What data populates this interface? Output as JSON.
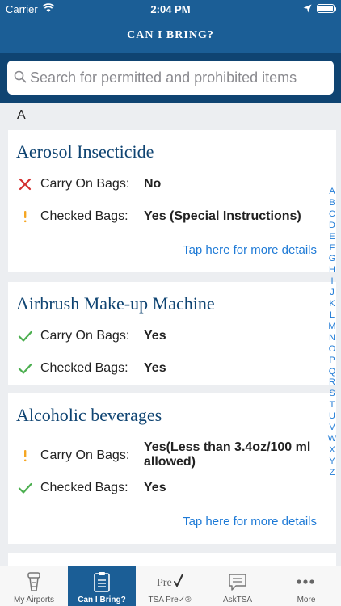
{
  "status": {
    "carrier": "Carrier",
    "time": "2:04 PM"
  },
  "nav": {
    "title": "CAN I BRING?"
  },
  "search": {
    "placeholder": "Search for permitted and prohibited items"
  },
  "section": {
    "letter": "A"
  },
  "items": [
    {
      "title": "Aerosol Insecticide",
      "carry_on_label": "Carry On Bags:",
      "carry_on_value": "No",
      "carry_on_status": "no",
      "checked_label": "Checked Bags:",
      "checked_value": "Yes (Special Instructions)",
      "checked_status": "special",
      "details": "Tap here for more details"
    },
    {
      "title": "Airbrush Make-up Machine",
      "carry_on_label": "Carry On Bags:",
      "carry_on_value": "Yes",
      "carry_on_status": "yes",
      "checked_label": "Checked Bags:",
      "checked_value": "Yes",
      "checked_status": "yes"
    },
    {
      "title": "Alcoholic beverages",
      "carry_on_label": "Carry On Bags:",
      "carry_on_value": "Yes(Less than 3.4oz/100 ml allowed)",
      "carry_on_status": "special",
      "checked_label": "Checked Bags:",
      "checked_value": "Yes",
      "checked_status": "yes",
      "details": "Tap here for more details"
    }
  ],
  "index": [
    "A",
    "B",
    "C",
    "D",
    "E",
    "F",
    "G",
    "H",
    "I",
    "J",
    "K",
    "L",
    "M",
    "N",
    "O",
    "P",
    "Q",
    "R",
    "S",
    "T",
    "U",
    "V",
    "W",
    "X",
    "Y",
    "Z"
  ],
  "tabs": [
    {
      "label": "My Airports",
      "icon": "tower-icon"
    },
    {
      "label": "Can I Bring?",
      "icon": "clipboard-icon",
      "active": true
    },
    {
      "label": "TSA Pre✓®",
      "icon": "precheck-icon"
    },
    {
      "label": "AskTSA",
      "icon": "chat-icon"
    },
    {
      "label": "More",
      "icon": "more-icon"
    }
  ],
  "colors": {
    "nav": "#1b5e96",
    "search_bg": "#0f4472",
    "title": "#0f4472",
    "link": "#1e7ad6",
    "no": "#d32f2f",
    "yes": "#4caf50",
    "special": "#f5a623"
  }
}
